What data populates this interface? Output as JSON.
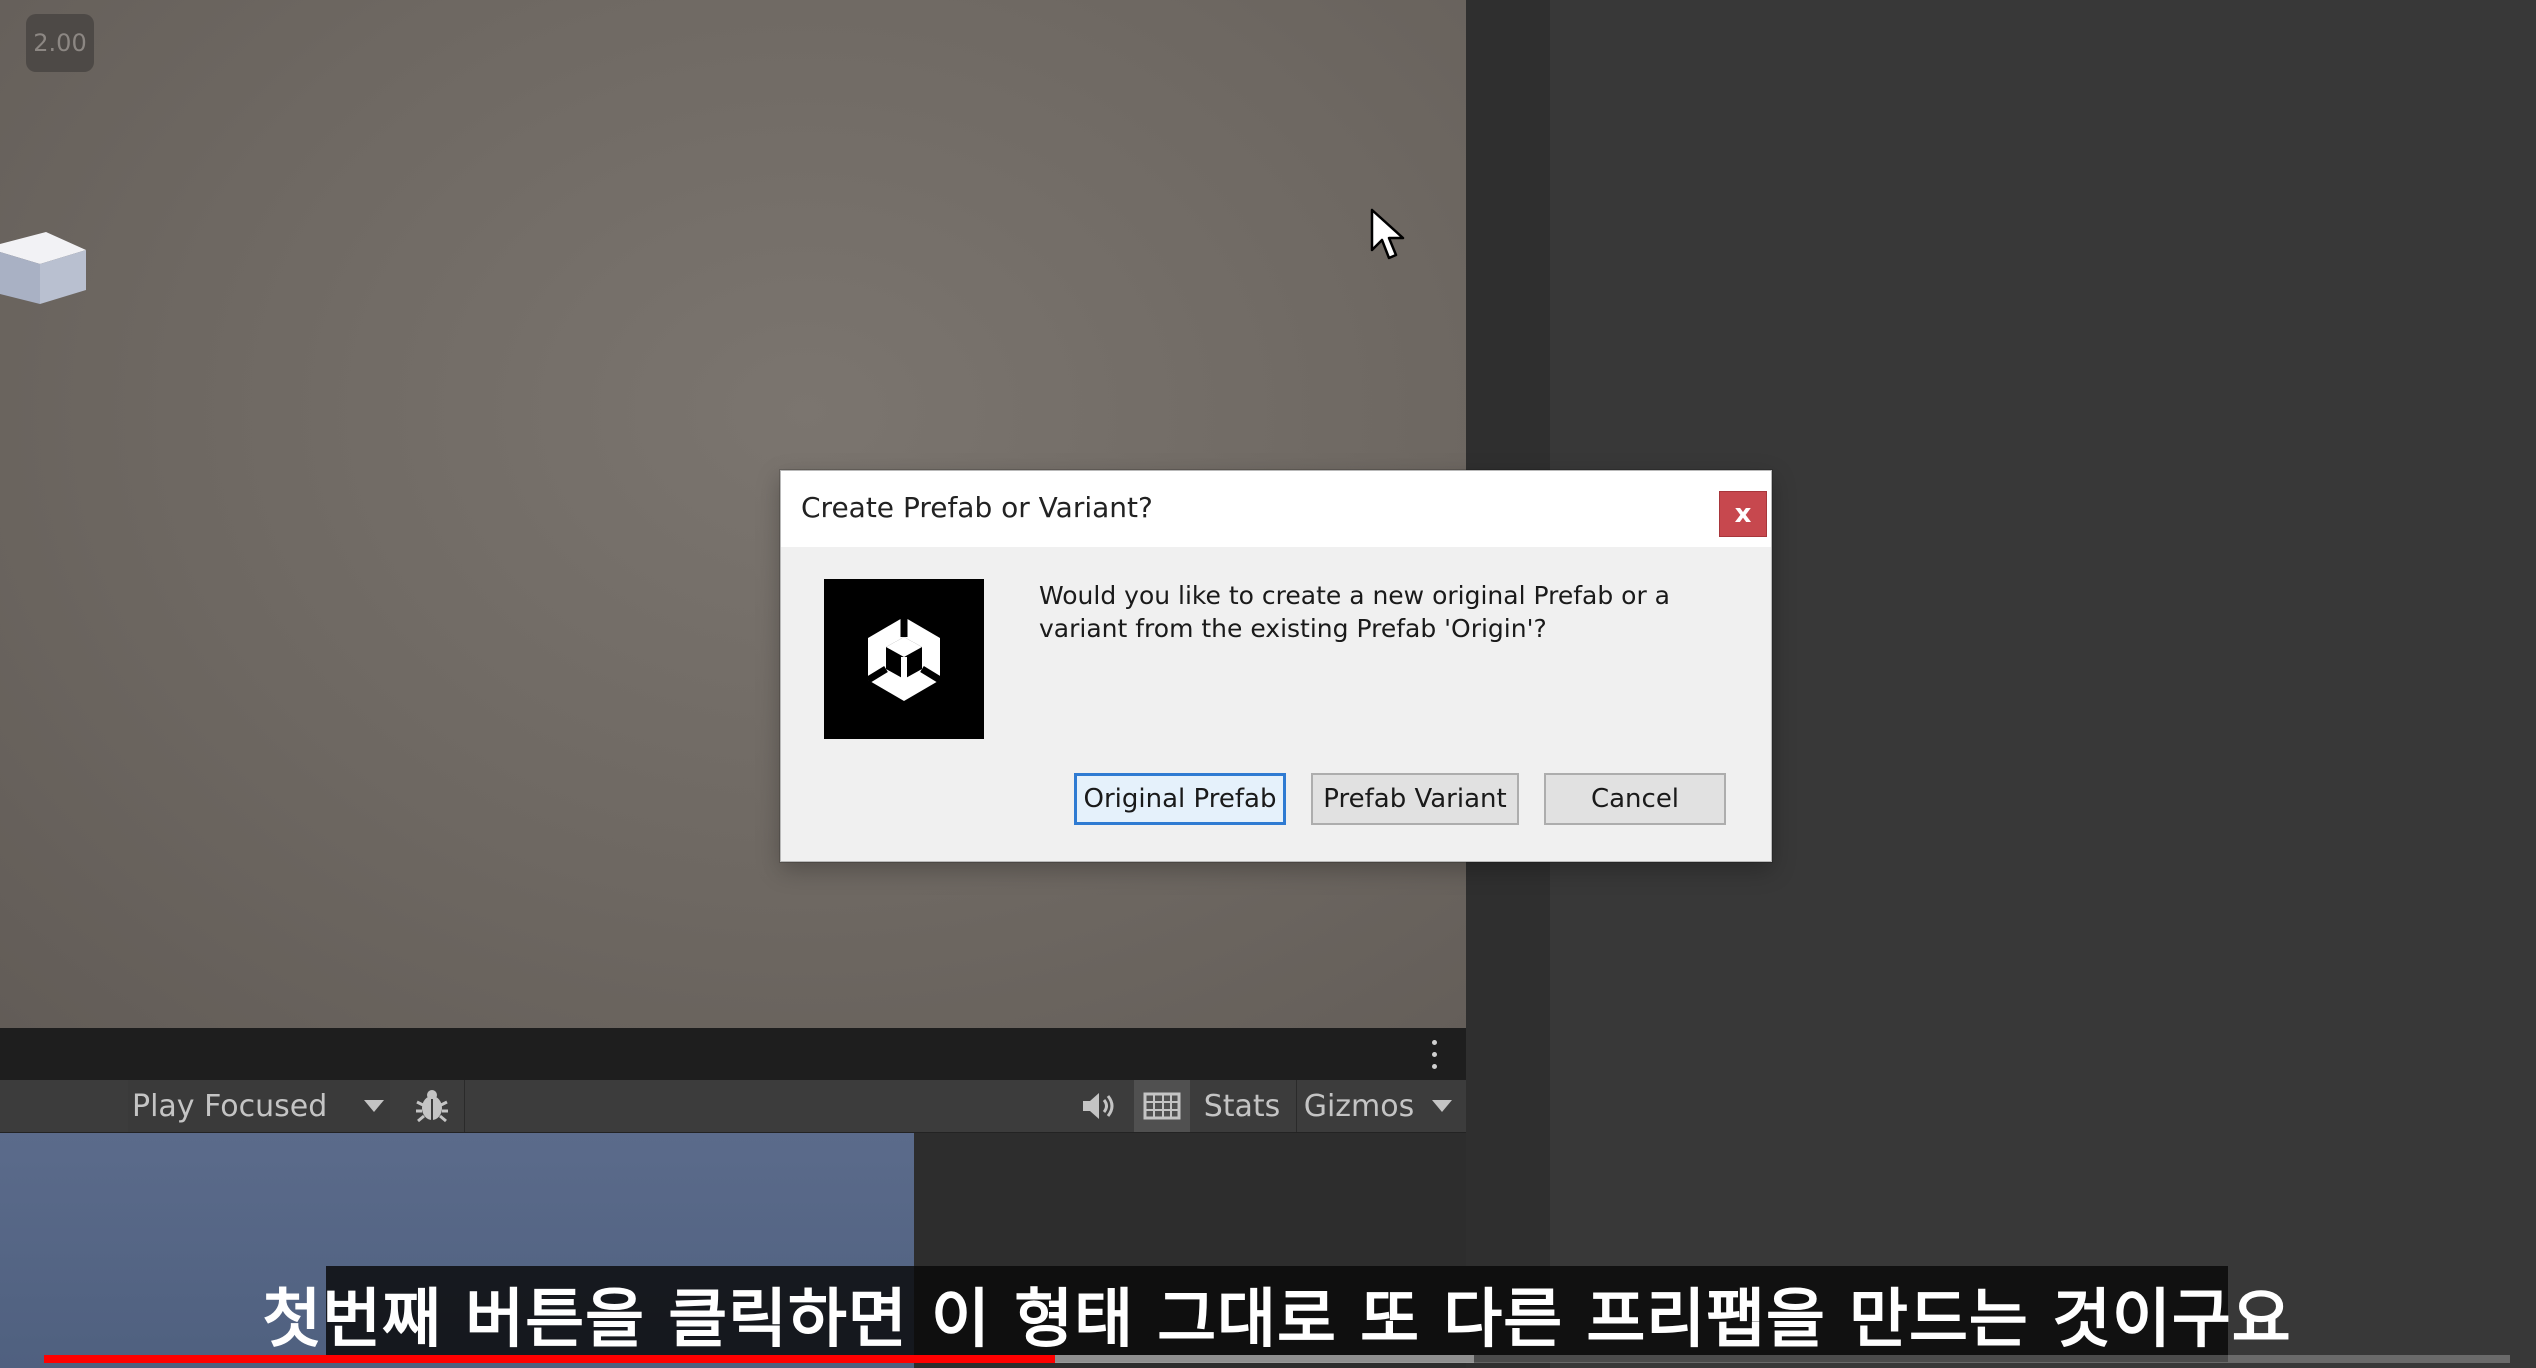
{
  "overlay": {
    "zoom_level": "2.00"
  },
  "dialog": {
    "title": "Create Prefab or Variant?",
    "close_label": "x",
    "message_line1": "Would you like to create a new original Prefab or a",
    "message_line2": "variant from the existing Prefab 'Origin'?",
    "buttons": {
      "original": "Original Prefab",
      "variant": "Prefab Variant",
      "cancel": "Cancel"
    }
  },
  "game_toolbar": {
    "play_mode": "Play Focused",
    "stats": "Stats",
    "gizmos": "Gizmos",
    "icons": [
      "bug-icon",
      "audio-mute-icon",
      "stats-toggle-icon",
      "kebab-menu-icon",
      "chevron-down-icon"
    ]
  },
  "video": {
    "subtitle": "첫번째 버튼을 클릭하면 이 형태 그대로 또 다른 프리팹을 만드는 것이구요",
    "progress_played": 0.41,
    "progress_buffered": 0.58
  },
  "colors": {
    "close_button": "#c7484e",
    "primary_button_border": "#2f7bd2",
    "progress_played": "#ff0000"
  }
}
